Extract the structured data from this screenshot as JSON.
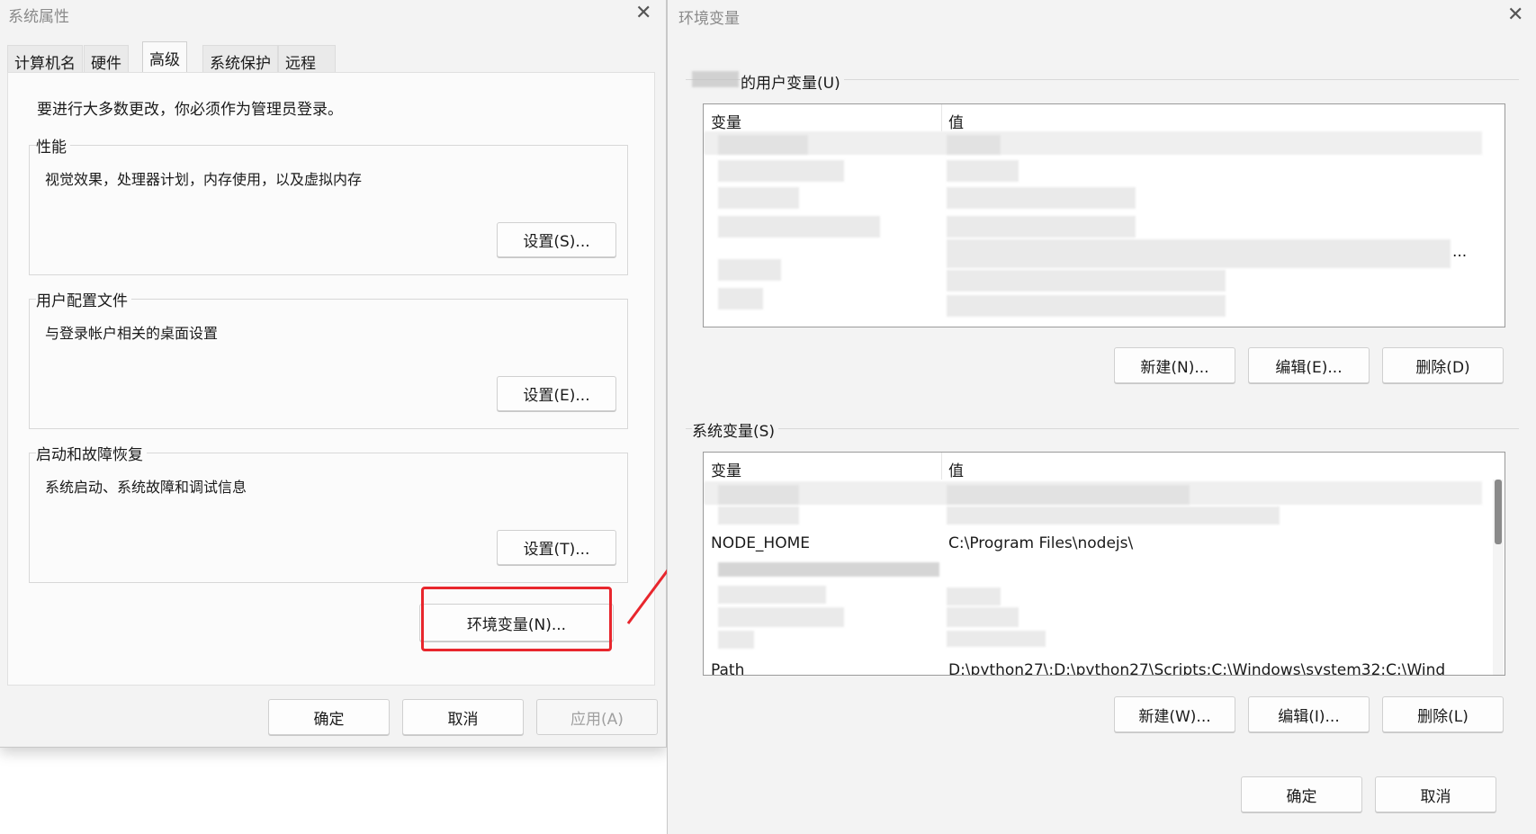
{
  "sysprops": {
    "title": "系统属性",
    "tabs": [
      {
        "label": "计算机名"
      },
      {
        "label": "硬件"
      },
      {
        "label": "高级"
      },
      {
        "label": "系统保护"
      },
      {
        "label": "远程"
      }
    ],
    "active_tab": "高级",
    "admin_notice": "要进行大多数更改，你必须作为管理员登录。",
    "performance": {
      "label": "性能",
      "desc": "视觉效果，处理器计划，内存使用，以及虚拟内存",
      "button": "设置(S)..."
    },
    "profiles": {
      "label": "用户配置文件",
      "desc": "与登录帐户相关的桌面设置",
      "button": "设置(E)..."
    },
    "startup": {
      "label": "启动和故障恢复",
      "desc": "系统启动、系统故障和调试信息",
      "button": "设置(T)..."
    },
    "env_button": "环境变量(N)...",
    "ok": "确定",
    "cancel": "取消",
    "apply": "应用(A)"
  },
  "envvars": {
    "title": "环境变量",
    "user_section": {
      "label": "的用户变量(U)",
      "col_var": "变量",
      "col_val": "值",
      "truncation_mark": "...",
      "new": "新建(N)...",
      "edit": "编辑(E)...",
      "delete": "删除(D)"
    },
    "system_section": {
      "label": "系统变量(S)",
      "col_var": "变量",
      "col_val": "值",
      "rows": [
        {
          "name": "NODE_HOME",
          "value": "C:\\Program Files\\nodejs\\"
        },
        {
          "name": "Path",
          "value": "D:\\python27\\;D:\\python27\\Scripts;C:\\Windows\\system32;C:\\Wind"
        }
      ],
      "new": "新建(W)...",
      "edit": "编辑(I)...",
      "delete": "删除(L)"
    },
    "ok": "确定",
    "cancel": "取消"
  },
  "colors": {
    "highlight": "#e8262d",
    "dialog_bg": "#f3f3f3"
  }
}
